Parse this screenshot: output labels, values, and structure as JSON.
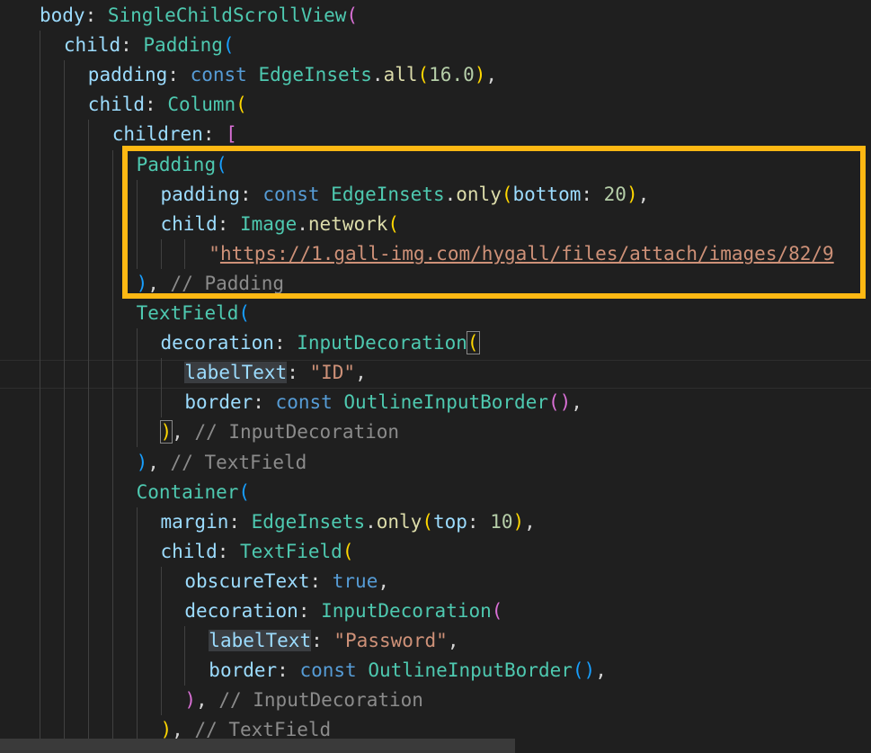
{
  "colors": {
    "background": "#1f1f1f",
    "highlight_box": "#fdb813",
    "property": "#9cdcfe",
    "class": "#4ec9b0",
    "keyword": "#569cd6",
    "method": "#dcdcaa",
    "number": "#b5cea8",
    "string": "#ce9178",
    "comment": "#8b8b8b",
    "bracket_level_1": "#ffd700",
    "bracket_level_2": "#da70d6",
    "bracket_level_3": "#179fff"
  },
  "code_lines": [
    [
      {
        "t": "body",
        "c": "prop"
      },
      {
        "t": ": ",
        "c": "punc"
      },
      {
        "t": "SingleChildScrollView",
        "c": "cls"
      },
      {
        "t": "(",
        "c": "br2"
      }
    ],
    [
      {
        "t": "child",
        "c": "prop"
      },
      {
        "t": ": ",
        "c": "punc"
      },
      {
        "t": "Padding",
        "c": "cls"
      },
      {
        "t": "(",
        "c": "br3"
      }
    ],
    [
      {
        "t": "padding",
        "c": "prop"
      },
      {
        "t": ": ",
        "c": "punc"
      },
      {
        "t": "const ",
        "c": "kw"
      },
      {
        "t": "EdgeInsets",
        "c": "cls"
      },
      {
        "t": ".",
        "c": "punc"
      },
      {
        "t": "all",
        "c": "fn"
      },
      {
        "t": "(",
        "c": "br1"
      },
      {
        "t": "16.0",
        "c": "num"
      },
      {
        "t": ")",
        "c": "br1"
      },
      {
        "t": ",",
        "c": "punc"
      }
    ],
    [
      {
        "t": "child",
        "c": "prop"
      },
      {
        "t": ": ",
        "c": "punc"
      },
      {
        "t": "Column",
        "c": "cls"
      },
      {
        "t": "(",
        "c": "br1"
      }
    ],
    [
      {
        "t": "children",
        "c": "prop"
      },
      {
        "t": ": ",
        "c": "punc"
      },
      {
        "t": "[",
        "c": "br2"
      }
    ],
    [
      {
        "t": "Padding",
        "c": "cls"
      },
      {
        "t": "(",
        "c": "br3"
      }
    ],
    [
      {
        "t": "padding",
        "c": "prop"
      },
      {
        "t": ": ",
        "c": "punc"
      },
      {
        "t": "const ",
        "c": "kw"
      },
      {
        "t": "EdgeInsets",
        "c": "cls"
      },
      {
        "t": ".",
        "c": "punc"
      },
      {
        "t": "only",
        "c": "fn"
      },
      {
        "t": "(",
        "c": "br1"
      },
      {
        "t": "bottom",
        "c": "prop"
      },
      {
        "t": ": ",
        "c": "punc"
      },
      {
        "t": "20",
        "c": "num"
      },
      {
        "t": ")",
        "c": "br1"
      },
      {
        "t": ",",
        "c": "punc"
      }
    ],
    [
      {
        "t": "child",
        "c": "prop"
      },
      {
        "t": ": ",
        "c": "punc"
      },
      {
        "t": "Image",
        "c": "cls"
      },
      {
        "t": ".",
        "c": "punc"
      },
      {
        "t": "network",
        "c": "fn"
      },
      {
        "t": "(",
        "c": "br1"
      }
    ],
    [
      {
        "t": "\"",
        "c": "str"
      },
      {
        "t": "https://1.gall-img.com/hygall/files/attach/images/82/9",
        "c": "url"
      }
    ],
    [
      {
        "t": ")",
        "c": "br3"
      },
      {
        "t": ", ",
        "c": "punc"
      },
      {
        "t": "// Padding",
        "c": "cmt"
      }
    ],
    [
      {
        "t": "TextField",
        "c": "cls"
      },
      {
        "t": "(",
        "c": "br3"
      }
    ],
    [
      {
        "t": "decoration",
        "c": "prop"
      },
      {
        "t": ": ",
        "c": "punc"
      },
      {
        "t": "InputDecoration",
        "c": "cls"
      },
      {
        "t": "(",
        "c": "br1",
        "hl": "brace"
      }
    ],
    [
      {
        "t": "labelText",
        "c": "prop",
        "hl": "word"
      },
      {
        "t": ": ",
        "c": "punc"
      },
      {
        "t": "\"ID\"",
        "c": "str"
      },
      {
        "t": ",",
        "c": "punc"
      }
    ],
    [
      {
        "t": "border",
        "c": "prop"
      },
      {
        "t": ": ",
        "c": "punc"
      },
      {
        "t": "const ",
        "c": "kw"
      },
      {
        "t": "OutlineInputBorder",
        "c": "cls"
      },
      {
        "t": "(",
        "c": "br2"
      },
      {
        "t": ")",
        "c": "br2"
      },
      {
        "t": ",",
        "c": "punc"
      }
    ],
    [
      {
        "t": ")",
        "c": "br1",
        "hl": "brace"
      },
      {
        "t": ", ",
        "c": "punc"
      },
      {
        "t": "// InputDecoration",
        "c": "cmt"
      }
    ],
    [
      {
        "t": ")",
        "c": "br3"
      },
      {
        "t": ", ",
        "c": "punc"
      },
      {
        "t": "// TextField",
        "c": "cmt"
      }
    ],
    [
      {
        "t": "Container",
        "c": "cls"
      },
      {
        "t": "(",
        "c": "br3"
      }
    ],
    [
      {
        "t": "margin",
        "c": "prop"
      },
      {
        "t": ": ",
        "c": "punc"
      },
      {
        "t": "EdgeInsets",
        "c": "cls"
      },
      {
        "t": ".",
        "c": "punc"
      },
      {
        "t": "only",
        "c": "fn"
      },
      {
        "t": "(",
        "c": "br1"
      },
      {
        "t": "top",
        "c": "prop"
      },
      {
        "t": ": ",
        "c": "punc"
      },
      {
        "t": "10",
        "c": "num"
      },
      {
        "t": ")",
        "c": "br1"
      },
      {
        "t": ",",
        "c": "punc"
      }
    ],
    [
      {
        "t": "child",
        "c": "prop"
      },
      {
        "t": ": ",
        "c": "punc"
      },
      {
        "t": "TextField",
        "c": "cls"
      },
      {
        "t": "(",
        "c": "br1"
      }
    ],
    [
      {
        "t": "obscureText",
        "c": "prop"
      },
      {
        "t": ": ",
        "c": "punc"
      },
      {
        "t": "true",
        "c": "kw"
      },
      {
        "t": ",",
        "c": "punc"
      }
    ],
    [
      {
        "t": "decoration",
        "c": "prop"
      },
      {
        "t": ": ",
        "c": "punc"
      },
      {
        "t": "InputDecoration",
        "c": "cls"
      },
      {
        "t": "(",
        "c": "br2"
      }
    ],
    [
      {
        "t": "labelText",
        "c": "prop",
        "hl": "word"
      },
      {
        "t": ": ",
        "c": "punc"
      },
      {
        "t": "\"Password\"",
        "c": "str"
      },
      {
        "t": ",",
        "c": "punc"
      }
    ],
    [
      {
        "t": "border",
        "c": "prop"
      },
      {
        "t": ": ",
        "c": "punc"
      },
      {
        "t": "const ",
        "c": "kw"
      },
      {
        "t": "OutlineInputBorder",
        "c": "cls"
      },
      {
        "t": "(",
        "c": "br3"
      },
      {
        "t": ")",
        "c": "br3"
      },
      {
        "t": ",",
        "c": "punc"
      }
    ],
    [
      {
        "t": ")",
        "c": "br2"
      },
      {
        "t": ", ",
        "c": "punc"
      },
      {
        "t": "// InputDecoration",
        "c": "cmt"
      }
    ],
    [
      {
        "t": ")",
        "c": "br1"
      },
      {
        "t": ", ",
        "c": "punc"
      },
      {
        "t": "// TextField",
        "c": "cmt"
      }
    ]
  ]
}
